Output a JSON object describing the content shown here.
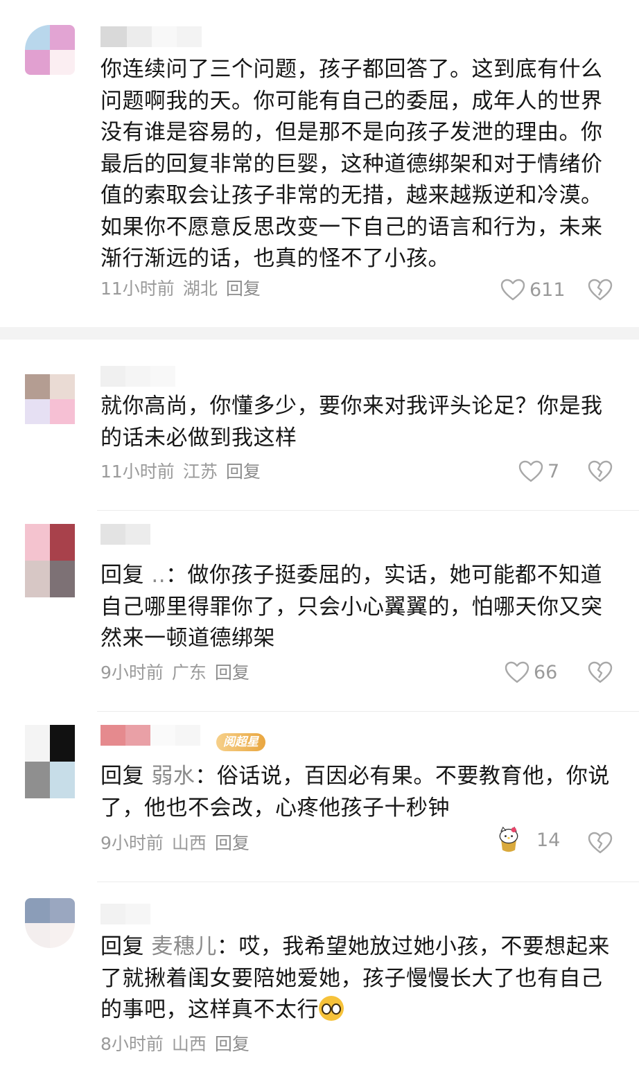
{
  "colors": {
    "text": "#161616",
    "meta": "#9a9a9a",
    "reply_name": "#8a8a8a",
    "badge": "#e9a63f",
    "divider": "#ececec"
  },
  "comments": [
    {
      "text": "你连续问了三个问题，孩子都回答了。这到底有什么问题啊我的天。你可能有自己的委屈，成年人的世界没有谁是容易的，但是那不是向孩子发泄的理由。你最后的回复非常的巨婴，这种道德绑架和对于情绪价值的索取会让孩子非常的无措，越来越叛逆和冷漠。如果你不愿意反思改变一下自己的语言和行为，未来渐行渐远的话，也真的怪不了小孩。",
      "time": "11小时前",
      "location": "湖北",
      "reply_label": "回复",
      "likes": "611",
      "icons": {
        "like": "heart-outline-icon",
        "dislike": "broken-heart-icon"
      }
    },
    {
      "text": "就你高尚，你懂多少，要你来对我评头论足？你是我的话未必做到我这样",
      "time": "11小时前",
      "location": "江苏",
      "reply_label": "回复",
      "likes": "7",
      "icons": {
        "like": "heart-outline-icon",
        "dislike": "broken-heart-icon"
      }
    },
    {
      "reply_prefix": "回复",
      "reply_to": " ..",
      "text": "：做你孩子挺委屈的，实话，她可能都不知道自己哪里得罪你了，只会小心翼翼的，怕哪天你又突然来一顿道德绑架",
      "time": "9小时前",
      "location": "广东",
      "reply_label": "回复",
      "likes": "66",
      "icons": {
        "like": "heart-outline-icon",
        "dislike": "broken-heart-icon"
      }
    },
    {
      "badge": "阅超星",
      "reply_prefix": "回复",
      "reply_to": " 弱水",
      "text": "：俗话说，百因必有果。不要教育他，你说了，他也不会改，心疼他孩子十秒钟",
      "time": "9小时前",
      "location": "山西",
      "reply_label": "回复",
      "likes": "14",
      "icons": {
        "like": "hello-kitty-sticker-icon",
        "dislike": "broken-heart-icon"
      }
    },
    {
      "reply_prefix": "回复",
      "reply_to": " 麦穗儿",
      "text": "：哎，我希望她放过她小孩，不要想起来了就揪着闺女要陪她爱她，孩子慢慢长大了也有自己的事吧，这样真不太行",
      "time": "8小时前",
      "location": "山西",
      "reply_label": "回复",
      "icons": {
        "emoji": "pleading-face-emoji-icon"
      }
    }
  ]
}
